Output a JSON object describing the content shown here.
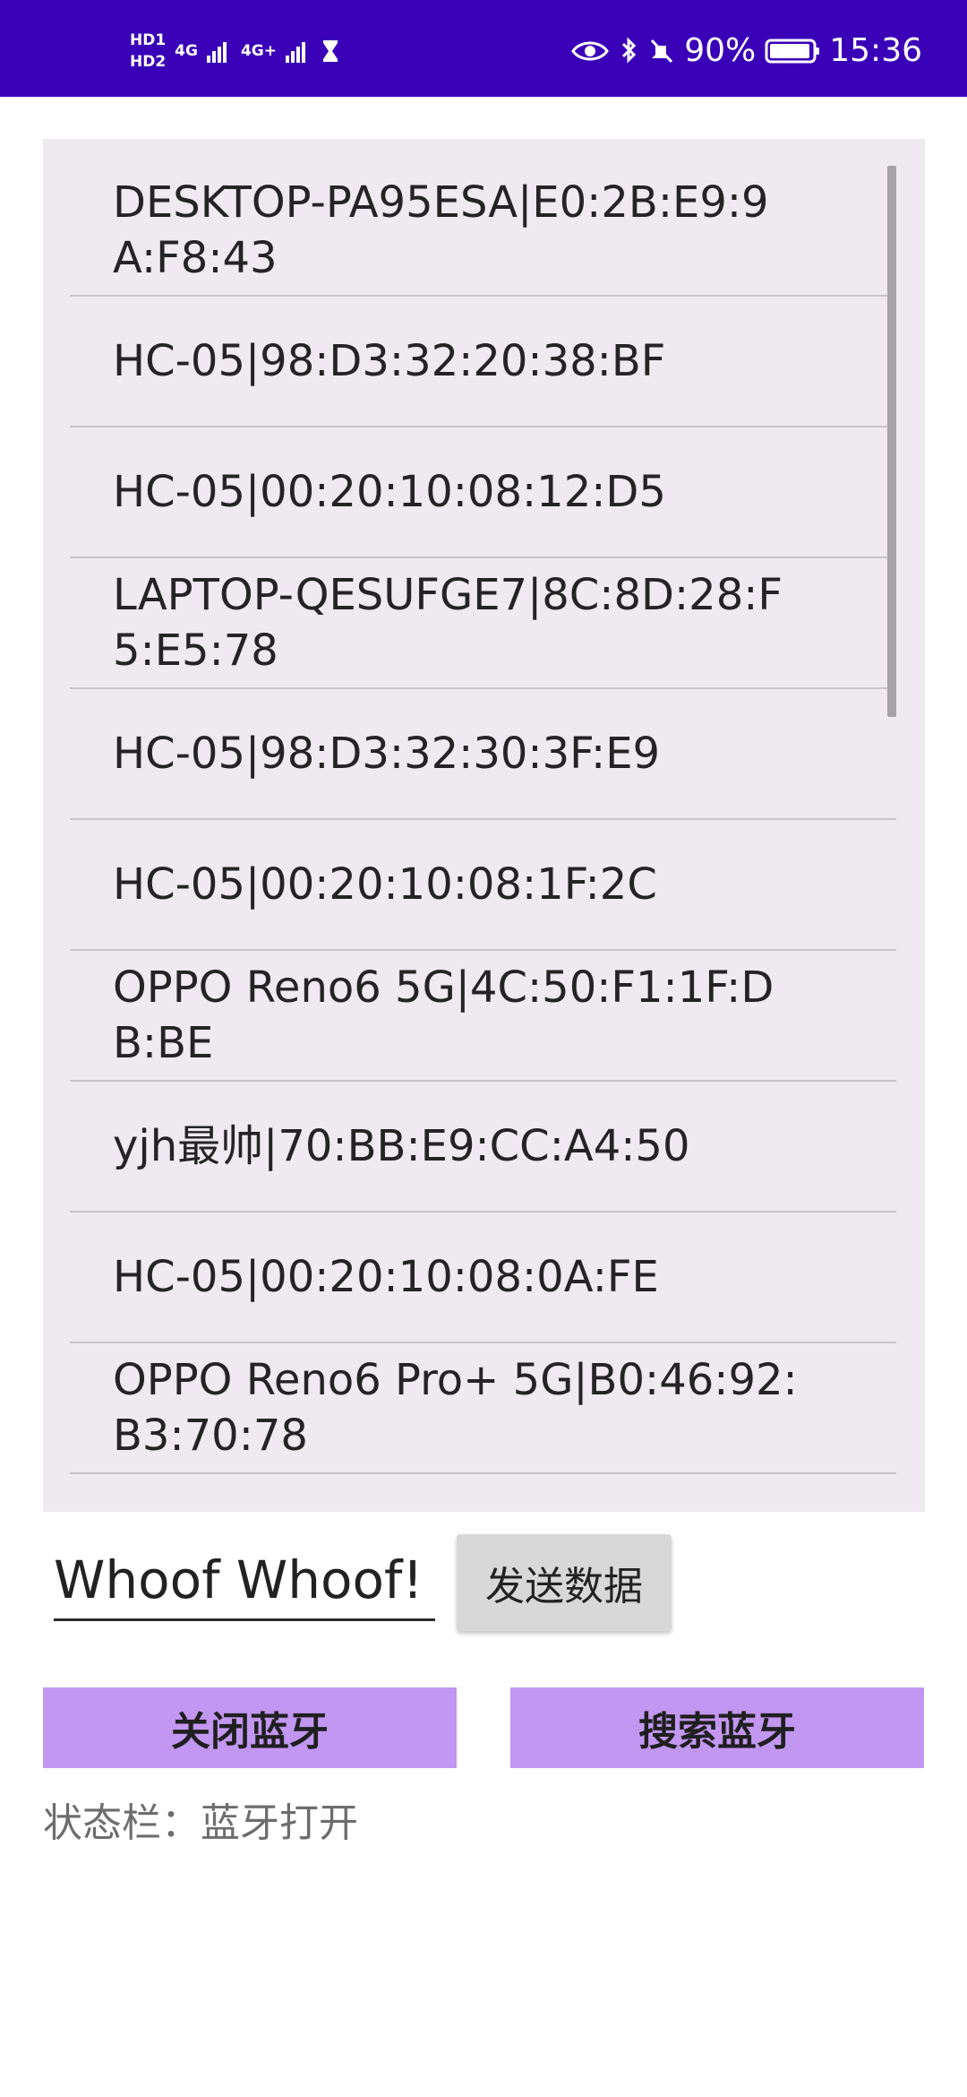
{
  "status_bar": {
    "hd1": "HD1",
    "hd2": "HD2",
    "network1": "4G",
    "network2": "4G+",
    "battery_percent": "90%",
    "time": "15:36",
    "bg_color": "#3a00b8",
    "icons": [
      "hd-icon",
      "signal-icon",
      "hourglass-icon",
      "eye-icon",
      "bluetooth-icon",
      "mute-icon",
      "battery-icon"
    ]
  },
  "devices": [
    {
      "text": "DESKTOP-PA95ESA|E0:2B:E9:9A:F8:43"
    },
    {
      "text": "HC-05|98:D3:32:20:38:BF"
    },
    {
      "text": "HC-05|00:20:10:08:12:D5"
    },
    {
      "text": "LAPTOP-QESUFGE7|8C:8D:28:F5:E5:78"
    },
    {
      "text": "HC-05|98:D3:32:30:3F:E9"
    },
    {
      "text": "HC-05|00:20:10:08:1F:2C"
    },
    {
      "text": "OPPO Reno6 5G|4C:50:F1:1F:DB:BE"
    },
    {
      "text": "yjh最帅|70:BB:E9:CC:A4:50"
    },
    {
      "text": "HC-05|00:20:10:08:0A:FE"
    },
    {
      "text": "OPPO Reno6 Pro+ 5G|B0:46:92:B3:70:78"
    }
  ],
  "message_input": {
    "value": "Whoof Whoof!"
  },
  "send_button": {
    "label": "发送数据"
  },
  "close_bluetooth_button": {
    "label": "关闭蓝牙",
    "color": "#c297f1"
  },
  "search_bluetooth_button": {
    "label": "搜索蓝牙",
    "color": "#c297f1"
  },
  "status_line": {
    "label": "状态栏：",
    "value": "蓝牙打开"
  }
}
